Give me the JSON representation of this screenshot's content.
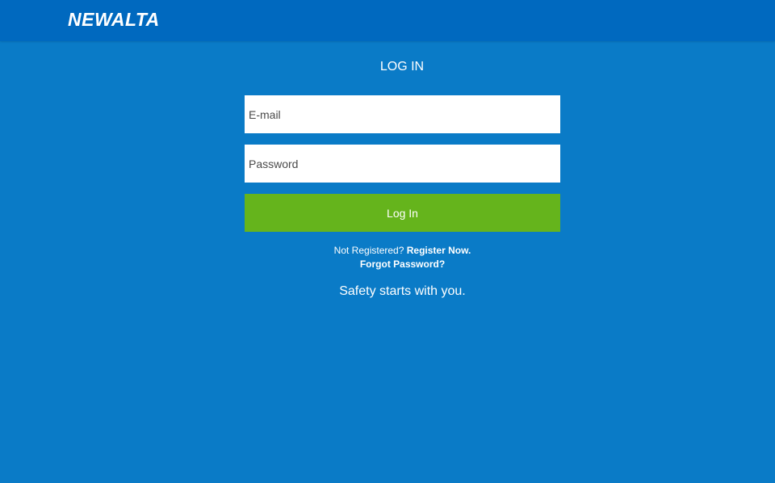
{
  "header": {
    "logo_text": "NEWALTA"
  },
  "login": {
    "title": "LOG IN",
    "email_placeholder": "E-mail",
    "email_value": "",
    "password_placeholder": "Password",
    "password_value": "",
    "submit_label": "Log In",
    "not_registered_text": "Not Registered?",
    "register_link": "Register Now.",
    "forgot_link": "Forgot Password?",
    "tagline": "Safety starts with you."
  },
  "colors": {
    "background": "#0a7bc7",
    "header": "#0069bf",
    "button": "#65b41c",
    "text": "#ffffff"
  }
}
